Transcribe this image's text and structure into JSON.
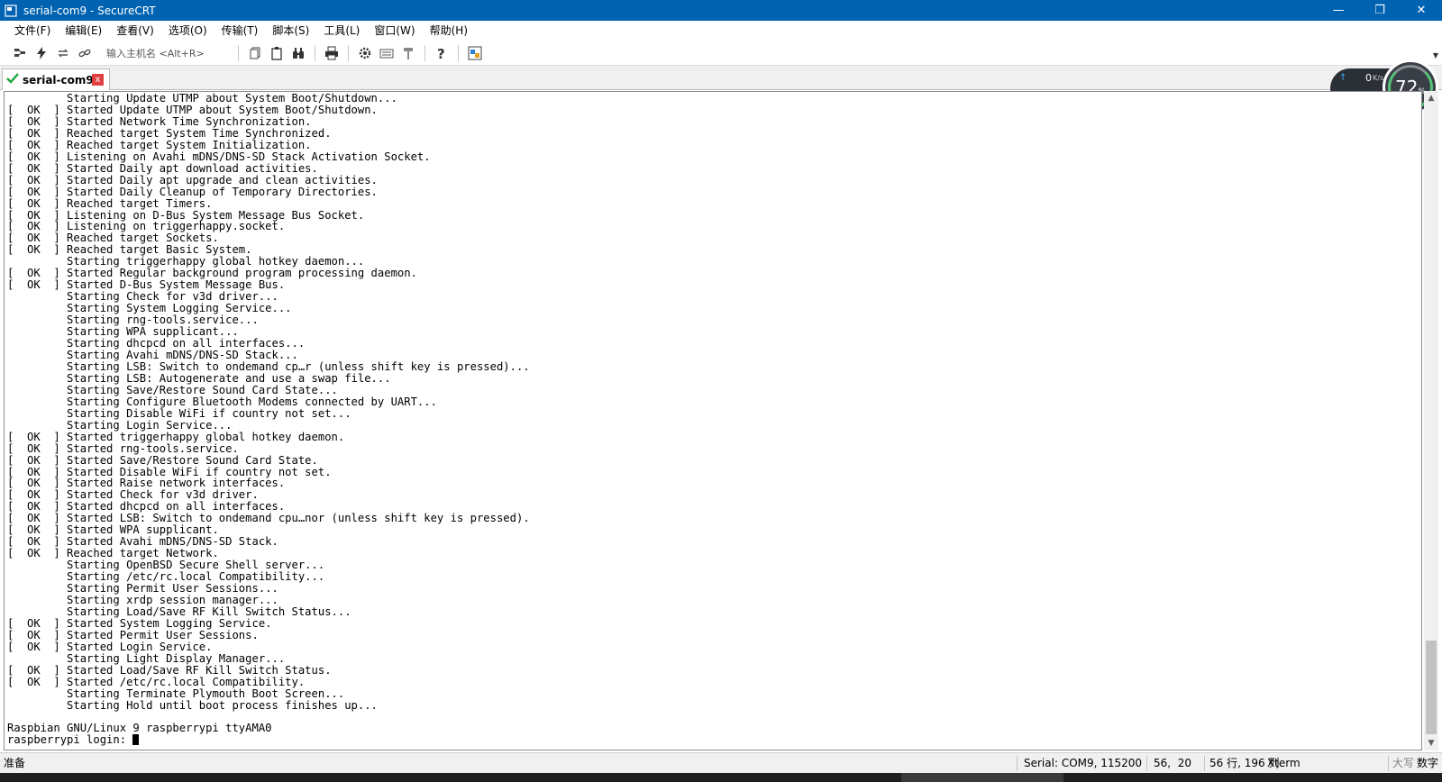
{
  "window": {
    "title": "serial-com9 - SecureCRT",
    "minimize": "—",
    "restore": "❐",
    "close": "✕"
  },
  "menu": [
    "文件(F)",
    "编辑(E)",
    "查看(V)",
    "选项(O)",
    "传输(T)",
    "脚本(S)",
    "工具(L)",
    "窗口(W)",
    "帮助(H)"
  ],
  "toolbar": {
    "host_placeholder": "输入主机名 <Alt+R>",
    "icons_left": [
      "connect-bar-icon",
      "lightning-icon",
      "reconnect-icon",
      "disconnect-icon"
    ],
    "icons_mid": [
      "copy-icon",
      "paste-icon",
      "find-icon"
    ],
    "icons_print": [
      "print-icon"
    ],
    "icons_right": [
      "settings-gear-icon",
      "keymap-icon",
      "session-options-icon"
    ],
    "icons_help": [
      "help-icon",
      "sftp-icon"
    ]
  },
  "tab": {
    "label": "serial-com9",
    "close": "x"
  },
  "network_widget": {
    "upload_value": "0",
    "download_value": "0",
    "unit": "K/s",
    "cpu_percent": "72",
    "percent_sign": "%"
  },
  "terminal": {
    "lines": [
      "         Starting Update UTMP about System Boot/Shutdown...",
      "[  OK  ] Started Update UTMP about System Boot/Shutdown.",
      "[  OK  ] Started Network Time Synchronization.",
      "[  OK  ] Reached target System Time Synchronized.",
      "[  OK  ] Reached target System Initialization.",
      "[  OK  ] Listening on Avahi mDNS/DNS-SD Stack Activation Socket.",
      "[  OK  ] Started Daily apt download activities.",
      "[  OK  ] Started Daily apt upgrade and clean activities.",
      "[  OK  ] Started Daily Cleanup of Temporary Directories.",
      "[  OK  ] Reached target Timers.",
      "[  OK  ] Listening on D-Bus System Message Bus Socket.",
      "[  OK  ] Listening on triggerhappy.socket.",
      "[  OK  ] Reached target Sockets.",
      "[  OK  ] Reached target Basic System.",
      "         Starting triggerhappy global hotkey daemon...",
      "[  OK  ] Started Regular background program processing daemon.",
      "[  OK  ] Started D-Bus System Message Bus.",
      "         Starting Check for v3d driver...",
      "         Starting System Logging Service...",
      "         Starting rng-tools.service...",
      "         Starting WPA supplicant...",
      "         Starting dhcpcd on all interfaces...",
      "         Starting Avahi mDNS/DNS-SD Stack...",
      "         Starting LSB: Switch to ondemand cp…r (unless shift key is pressed)...",
      "         Starting LSB: Autogenerate and use a swap file...",
      "         Starting Save/Restore Sound Card State...",
      "         Starting Configure Bluetooth Modems connected by UART...",
      "         Starting Disable WiFi if country not set...",
      "         Starting Login Service...",
      "[  OK  ] Started triggerhappy global hotkey daemon.",
      "[  OK  ] Started rng-tools.service.",
      "[  OK  ] Started Save/Restore Sound Card State.",
      "[  OK  ] Started Disable WiFi if country not set.",
      "[  OK  ] Started Raise network interfaces.",
      "[  OK  ] Started Check for v3d driver.",
      "[  OK  ] Started dhcpcd on all interfaces.",
      "[  OK  ] Started LSB: Switch to ondemand cpu…nor (unless shift key is pressed).",
      "[  OK  ] Started WPA supplicant.",
      "[  OK  ] Started Avahi mDNS/DNS-SD Stack.",
      "[  OK  ] Reached target Network.",
      "         Starting OpenBSD Secure Shell server...",
      "         Starting /etc/rc.local Compatibility...",
      "         Starting Permit User Sessions...",
      "         Starting xrdp session manager...",
      "         Starting Load/Save RF Kill Switch Status...",
      "[  OK  ] Started System Logging Service.",
      "[  OK  ] Started Permit User Sessions.",
      "[  OK  ] Started Login Service.",
      "         Starting Light Display Manager...",
      "[  OK  ] Started Load/Save RF Kill Switch Status.",
      "[  OK  ] Started /etc/rc.local Compatibility.",
      "         Starting Terminate Plymouth Boot Screen...",
      "         Starting Hold until boot process finishes up...",
      "",
      "Raspbian GNU/Linux 9 raspberrypi ttyAMA0"
    ],
    "prompt": "raspberrypi login: "
  },
  "statusbar": {
    "ready": "准备",
    "serial": "Serial: COM9, 115200",
    "cursor_pos": "56,  20",
    "size": "56 行, 196 列",
    "emulation": "Xterm",
    "caps": "大写",
    "num": "数字"
  }
}
